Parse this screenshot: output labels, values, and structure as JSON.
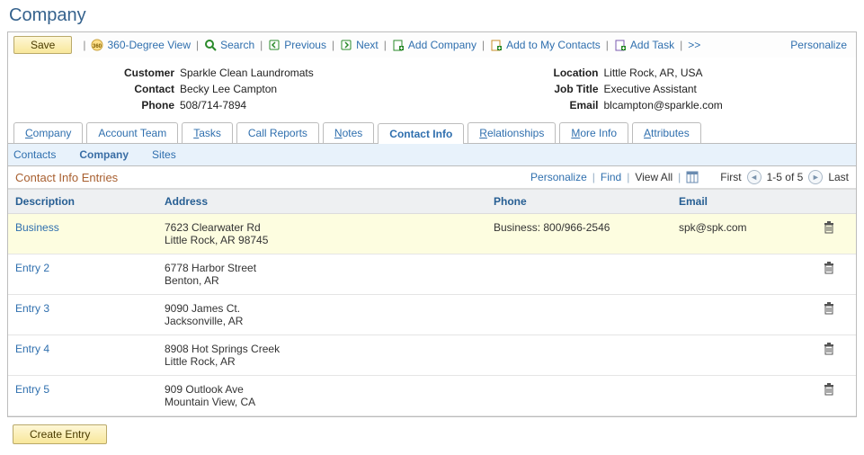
{
  "page_title": "Company",
  "toolbar": {
    "save": "Save",
    "view360": "360-Degree View",
    "search": "Search",
    "previous": "Previous",
    "next": "Next",
    "add_company": "Add Company",
    "add_my_contacts": "Add to My Contacts",
    "add_task": "Add Task",
    "more": ">>",
    "personalize": "Personalize"
  },
  "summary": {
    "customer_label": "Customer",
    "customer_value": "Sparkle Clean Laundromats",
    "contact_label": "Contact",
    "contact_value": "Becky Lee Campton",
    "phone_label": "Phone",
    "phone_value": "508/714-7894",
    "location_label": "Location",
    "location_value": "Little Rock, AR, USA",
    "jobtitle_label": "Job Title",
    "jobtitle_value": "Executive Assistant",
    "email_label": "Email",
    "email_value": "blcampton@sparkle.com"
  },
  "tabs": {
    "company": "Company",
    "account_team": "Account Team",
    "tasks": "Tasks",
    "call_reports": "Call Reports",
    "notes": "Notes",
    "contact_info": "Contact Info",
    "relationships": "Relationships",
    "more_info": "More Info",
    "attributes": "Attributes"
  },
  "subtabs": {
    "contacts": "Contacts",
    "company": "Company",
    "sites": "Sites"
  },
  "grid": {
    "title": "Contact Info Entries",
    "personalize": "Personalize",
    "find": "Find",
    "view_all": "View All",
    "first": "First",
    "range": "1-5 of 5",
    "last": "Last",
    "columns": {
      "description": "Description",
      "address": "Address",
      "phone": "Phone",
      "email": "Email"
    },
    "rows": [
      {
        "desc": "Business",
        "addr_line1": "7623 Clearwater Rd",
        "addr_line2": "Little Rock, AR 98745",
        "phone": "Business: 800/966-2546",
        "email": "spk@spk.com",
        "highlight": true
      },
      {
        "desc": "Entry 2",
        "addr_line1": "6778 Harbor Street",
        "addr_line2": "Benton, AR",
        "phone": "",
        "email": "",
        "highlight": false
      },
      {
        "desc": "Entry 3",
        "addr_line1": "9090 James Ct.",
        "addr_line2": "Jacksonville, AR",
        "phone": "",
        "email": "",
        "highlight": false
      },
      {
        "desc": "Entry 4",
        "addr_line1": "8908 Hot Springs Creek",
        "addr_line2": "Little Rock, AR",
        "phone": "",
        "email": "",
        "highlight": false
      },
      {
        "desc": "Entry 5",
        "addr_line1": "909 Outlook Ave",
        "addr_line2": "Mountain View, CA",
        "phone": "",
        "email": "",
        "highlight": false
      }
    ],
    "create_entry": "Create Entry"
  }
}
